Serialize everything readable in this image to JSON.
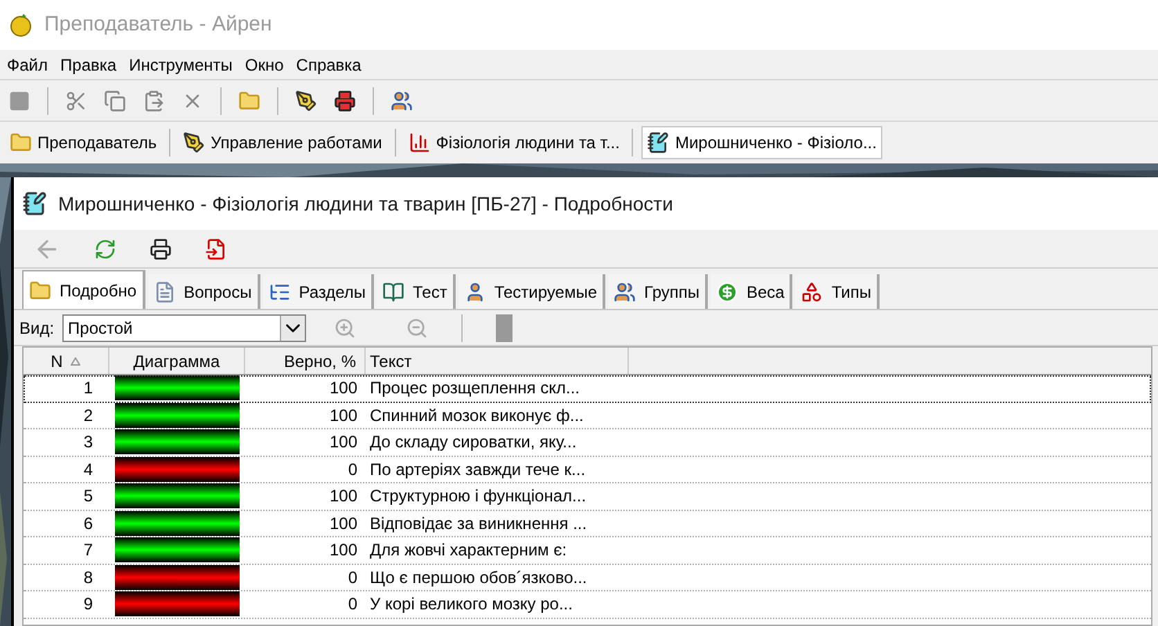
{
  "window": {
    "title": "Преподаватель - Айрен"
  },
  "menu": [
    "Файл",
    "Правка",
    "Инструменты",
    "Окно",
    "Справка"
  ],
  "window_tabs": [
    {
      "label": "Преподаватель",
      "selected": false
    },
    {
      "label": "Управление работами",
      "selected": false
    },
    {
      "label": "Фізіологія людини та т...",
      "selected": false
    },
    {
      "label": "Мирошниченко - Фізіоло...",
      "selected": true
    }
  ],
  "child": {
    "title": "Мирошниченко - Фізіологія людини та тварин [ПБ-27] - Подробности",
    "tabs": [
      {
        "label": "Подробно",
        "selected": true
      },
      {
        "label": "Вопросы",
        "selected": false
      },
      {
        "label": "Разделы",
        "selected": false
      },
      {
        "label": "Тест",
        "selected": false
      },
      {
        "label": "Тестируемые",
        "selected": false
      },
      {
        "label": "Группы",
        "selected": false
      },
      {
        "label": "Веса",
        "selected": false
      },
      {
        "label": "Типы",
        "selected": false
      }
    ],
    "view": {
      "label": "Вид:",
      "value": "Простой"
    },
    "table": {
      "columns": [
        "N",
        "Диаграмма",
        "Верно, %",
        "Текст"
      ],
      "rows": [
        {
          "n": "1",
          "correct": true,
          "percent": "100",
          "text": "Процес розщеплення скл...",
          "selected": true
        },
        {
          "n": "2",
          "correct": true,
          "percent": "100",
          "text": "Спинний мозок виконує ф...",
          "selected": false
        },
        {
          "n": "3",
          "correct": true,
          "percent": "100",
          "text": "До складу сироватки, яку...",
          "selected": false
        },
        {
          "n": "4",
          "correct": false,
          "percent": "0",
          "text": "По артеріях завжди тече к...",
          "selected": false
        },
        {
          "n": "5",
          "correct": true,
          "percent": "100",
          "text": "Структурною і функціонал...",
          "selected": false
        },
        {
          "n": "6",
          "correct": true,
          "percent": "100",
          "text": "Відповідає за виникнення ...",
          "selected": false
        },
        {
          "n": "7",
          "correct": true,
          "percent": "100",
          "text": "Для жовчі характерним є:",
          "selected": false
        },
        {
          "n": "8",
          "correct": false,
          "percent": "0",
          "text": "Що є першою обов´язково...",
          "selected": false
        },
        {
          "n": "9",
          "correct": false,
          "percent": "0",
          "text": "У корі великого мозку ро...",
          "selected": false
        }
      ]
    }
  }
}
